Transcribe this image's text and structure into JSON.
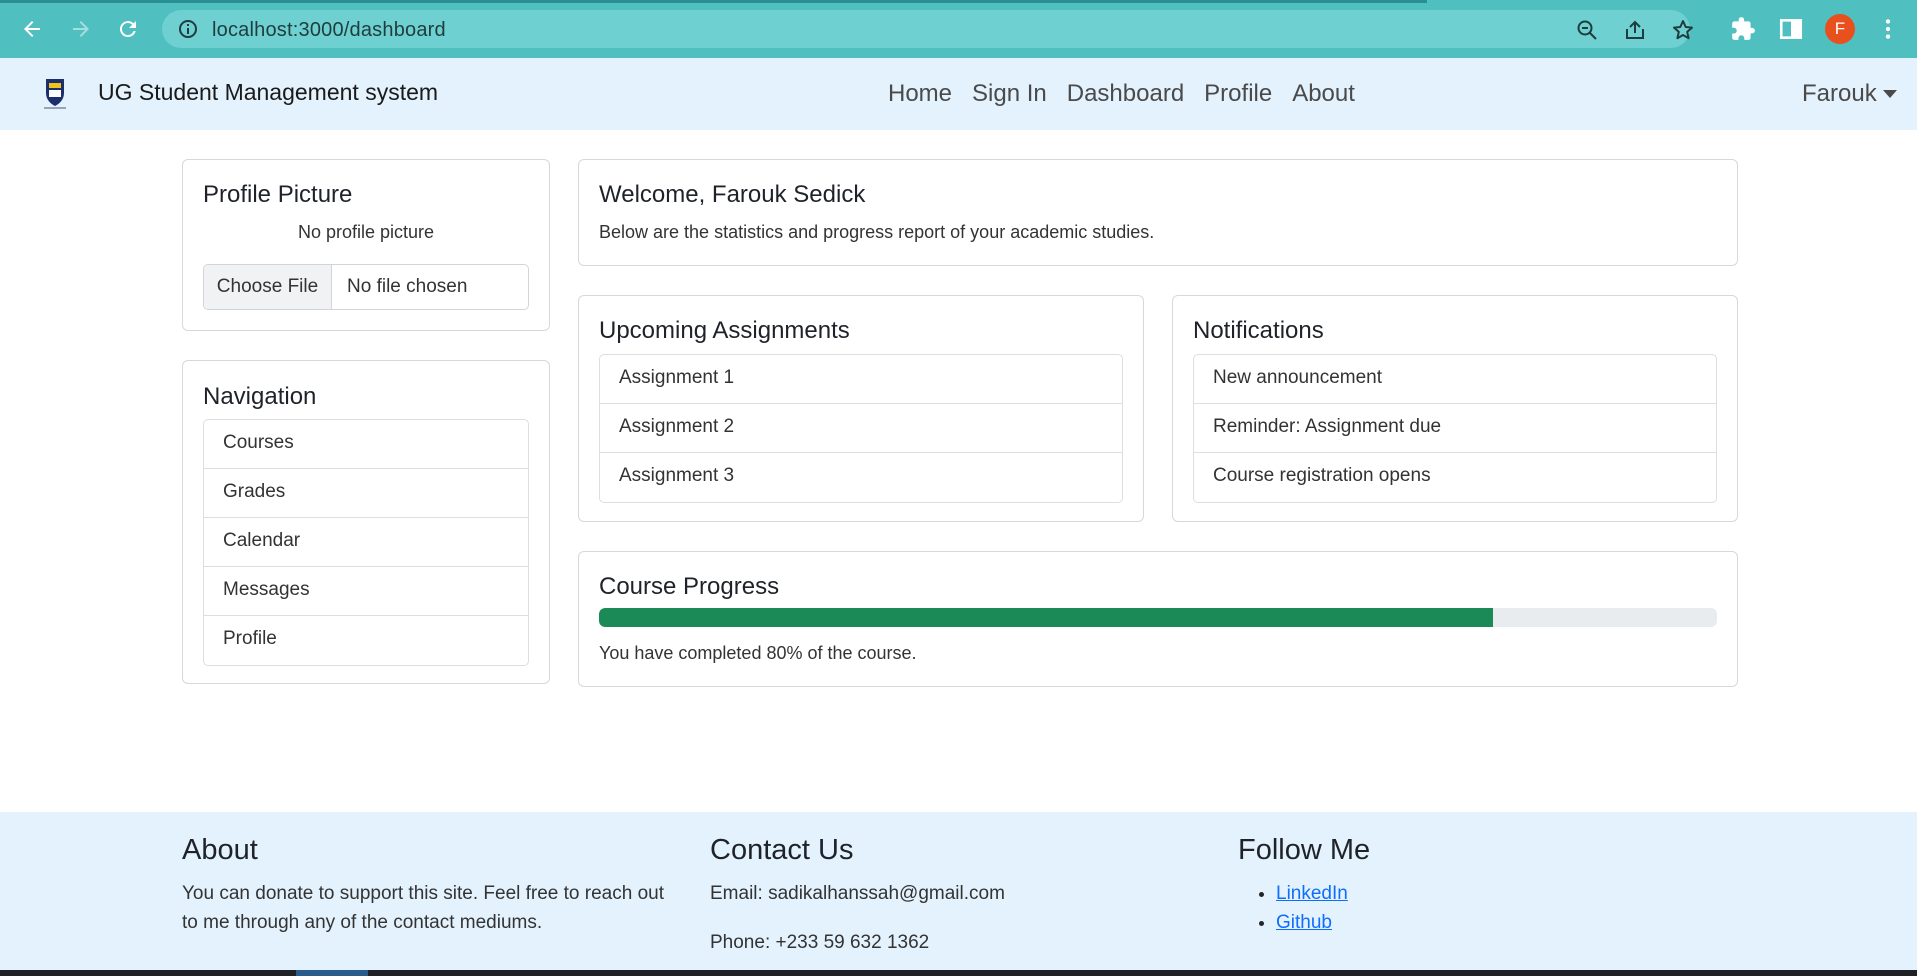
{
  "browser": {
    "url": "localhost:3000/dashboard",
    "profile_initial": "F",
    "accent": "#4fbfc0"
  },
  "navbar": {
    "brand": "UG Student Management system",
    "links": [
      "Home",
      "Sign In",
      "Dashboard",
      "Profile",
      "About"
    ],
    "user": "Farouk"
  },
  "profile_card": {
    "title": "Profile Picture",
    "status": "No profile picture",
    "file_button": "Choose File",
    "file_name": "No file chosen"
  },
  "navigation_card": {
    "title": "Navigation",
    "items": [
      "Courses",
      "Grades",
      "Calendar",
      "Messages",
      "Profile"
    ]
  },
  "welcome_card": {
    "title": "Welcome, Farouk Sedick",
    "text": "Below are the statistics and progress report of your academic studies."
  },
  "assignments_card": {
    "title": "Upcoming Assignments",
    "items": [
      "Assignment 1",
      "Assignment 2",
      "Assignment 3"
    ]
  },
  "notifications_card": {
    "title": "Notifications",
    "items": [
      "New announcement",
      "Reminder: Assignment due",
      "Course registration opens"
    ]
  },
  "progress_card": {
    "title": "Course Progress",
    "percent": 80,
    "text": "You have completed 80% of the course.",
    "bar_color": "#1b8a57"
  },
  "footer": {
    "about": {
      "title": "About",
      "text": "You can donate to support this site. Feel free to reach out to me through any of the contact mediums."
    },
    "contact": {
      "title": "Contact Us",
      "email": "Email: sadikalhanssah@gmail.com",
      "phone": "Phone: +233 59 632 1362"
    },
    "follow": {
      "title": "Follow Me",
      "links": [
        "LinkedIn",
        "Github"
      ]
    }
  },
  "icons": [
    "back-arrow-icon",
    "forward-arrow-icon",
    "reload-icon",
    "info-icon",
    "zoom-icon",
    "share-icon",
    "bookmark-star-icon",
    "extensions-puzzle-icon",
    "side-panel-icon",
    "more-menu-icon",
    "university-crest-logo"
  ]
}
